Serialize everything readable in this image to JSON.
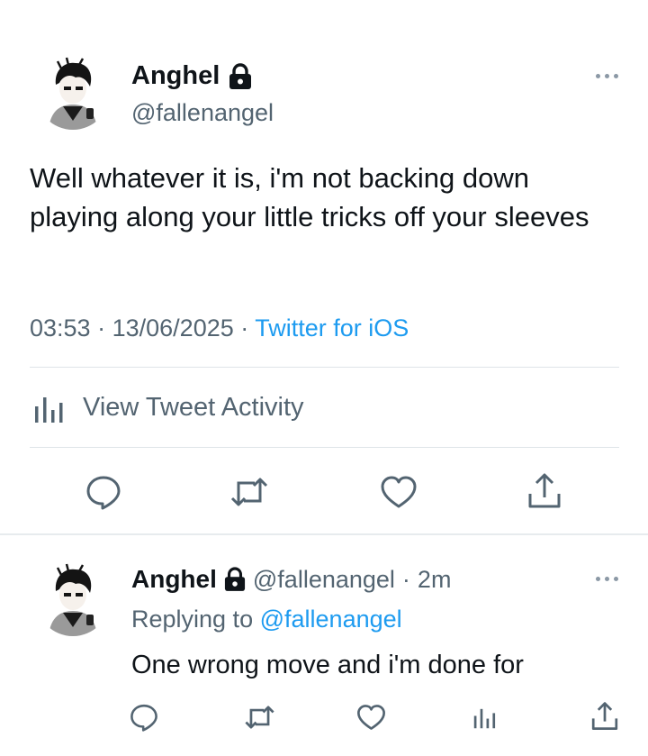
{
  "main_tweet": {
    "author_name": "Anghel",
    "author_handle": "@fallenangel",
    "text": "Well whatever it is, i'm not backing down playing along your little tricks off your sleeves",
    "time": "03:53",
    "separator": "·",
    "date": "13/06/2025",
    "source": "Twitter for iOS",
    "activity_label": "View Tweet Activity"
  },
  "reply_tweet": {
    "author_name": "Anghel",
    "author_handle": "@fallenangel",
    "separator": "·",
    "age": "2m",
    "replying_prefix": "Replying to",
    "replying_to": "@fallenangel",
    "text": "One wrong move and i'm done for"
  },
  "colors": {
    "text": "#0f1419",
    "secondary": "#536471",
    "link": "#1d9bf0",
    "divider": "#dfe4e8"
  },
  "icons": [
    "lock-icon",
    "more-icon",
    "activity-icon",
    "reply-icon",
    "retweet-icon",
    "like-icon",
    "share-icon"
  ]
}
